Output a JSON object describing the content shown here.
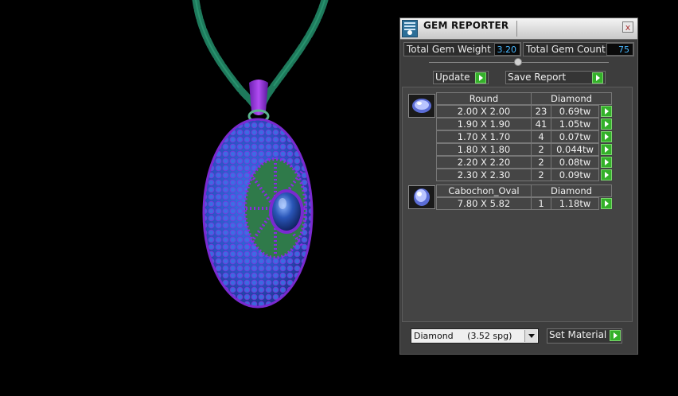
{
  "panel": {
    "title": "GEM REPORTER",
    "close_glyph": "x",
    "title_icon": "gem-reporter-icon"
  },
  "summary": {
    "weight_label": "Total Gem Weight",
    "weight_value": "3.20",
    "count_label": "Total Gem Count",
    "count_value": "75"
  },
  "actions": {
    "update_label": "Update",
    "save_label": "Save Report"
  },
  "groups": [
    {
      "shape": "Round",
      "material": "Diamond",
      "rows": [
        {
          "size": "2.00 X 2.00",
          "count": "23",
          "weight": "0.69tw"
        },
        {
          "size": "1.90 X 1.90",
          "count": "41",
          "weight": "1.05tw"
        },
        {
          "size": "1.70 X 1.70",
          "count": "4",
          "weight": "0.07tw"
        },
        {
          "size": "1.80 X 1.80",
          "count": "2",
          "weight": "0.044tw"
        },
        {
          "size": "2.20 X 2.20",
          "count": "2",
          "weight": "0.08tw"
        },
        {
          "size": "2.30 X 2.30",
          "count": "2",
          "weight": "0.09tw"
        }
      ]
    },
    {
      "shape": "Cabochon_Oval",
      "material": "Diamond",
      "rows": [
        {
          "size": "7.80 X 5.82",
          "count": "1",
          "weight": "1.18tw"
        }
      ]
    }
  ],
  "material": {
    "selected": "Diamond     (3.52 spg)",
    "set_label": "Set Material"
  },
  "colors": {
    "accent_value": "#49b8ff",
    "go_button": "#34b02a",
    "gem_blue": "#2a55c8",
    "prong_purple": "#8a2be2",
    "chain_green": "#1e7a5c"
  }
}
